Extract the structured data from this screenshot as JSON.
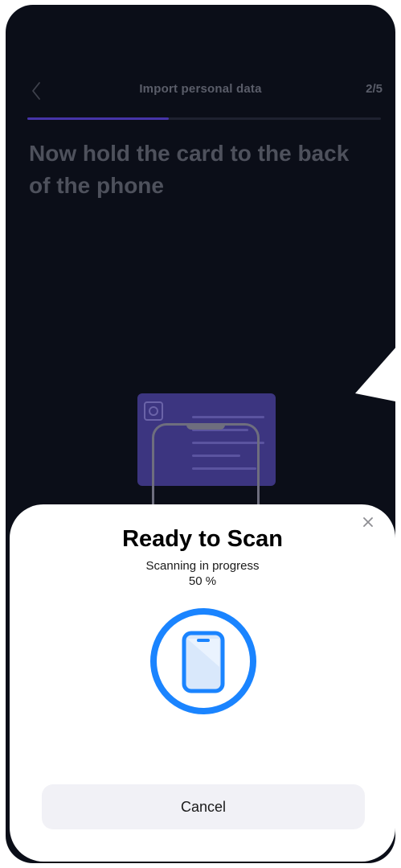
{
  "header": {
    "back_icon": "chevron-left-icon",
    "title": "Import personal data",
    "step": "2/5",
    "progress_fraction": 0.4
  },
  "main": {
    "headline": "Now hold the card to the back of the phone"
  },
  "scan_sheet": {
    "title": "Ready to Scan",
    "status": "Scanning in progress",
    "percent": "50 %",
    "close_icon": "close-icon",
    "scan_icon": "phone-in-circle-icon",
    "cancel_label": "Cancel"
  },
  "colors": {
    "background": "#0b0e18",
    "accent": "#4634a8",
    "scan_blue": "#1a84ff",
    "sheet_bg": "#ffffff"
  }
}
